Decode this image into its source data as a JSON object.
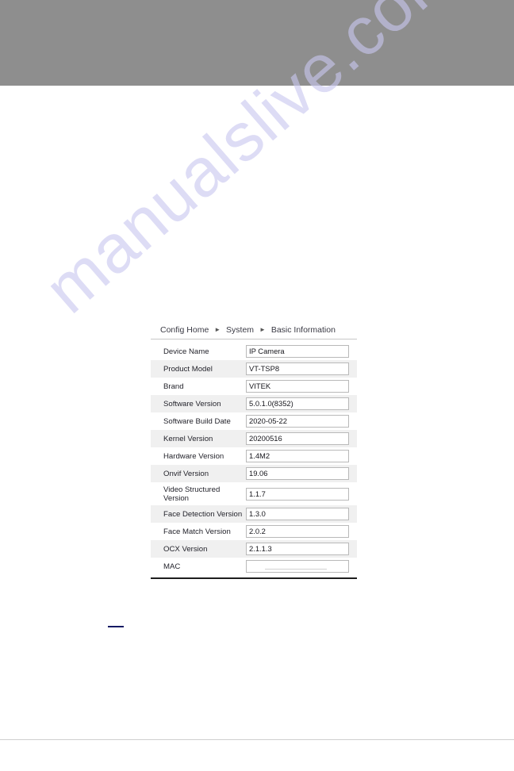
{
  "page": {
    "watermark": "manualslive.com",
    "banner_color": "#8e8e8e",
    "footer_rule_color": "#cfcfcf",
    "accent_mark_color": "#151a63"
  },
  "breadcrumb": {
    "items": [
      "Config Home",
      "System",
      "Basic Information"
    ],
    "separator": "►"
  },
  "basic_information": {
    "rows": [
      {
        "label": "Device Name",
        "value": "IP Camera"
      },
      {
        "label": "Product Model",
        "value": "VT-TSP8"
      },
      {
        "label": "Brand",
        "value": "VITEK"
      },
      {
        "label": "Software Version",
        "value": "5.0.1.0(8352)"
      },
      {
        "label": "Software Build Date",
        "value": "2020-05-22"
      },
      {
        "label": "Kernel Version",
        "value": "20200516"
      },
      {
        "label": "Hardware Version",
        "value": "1.4M2"
      },
      {
        "label": "Onvif Version",
        "value": "19.06"
      },
      {
        "label": "Video Structured\nVersion",
        "value": "1.1.7"
      },
      {
        "label": "Face Detection Version",
        "value": "1.3.0"
      },
      {
        "label": "Face Match Version",
        "value": "2.0.2"
      },
      {
        "label": "OCX Version",
        "value": "2.1.1.3"
      },
      {
        "label": "MAC",
        "value": ""
      }
    ]
  }
}
